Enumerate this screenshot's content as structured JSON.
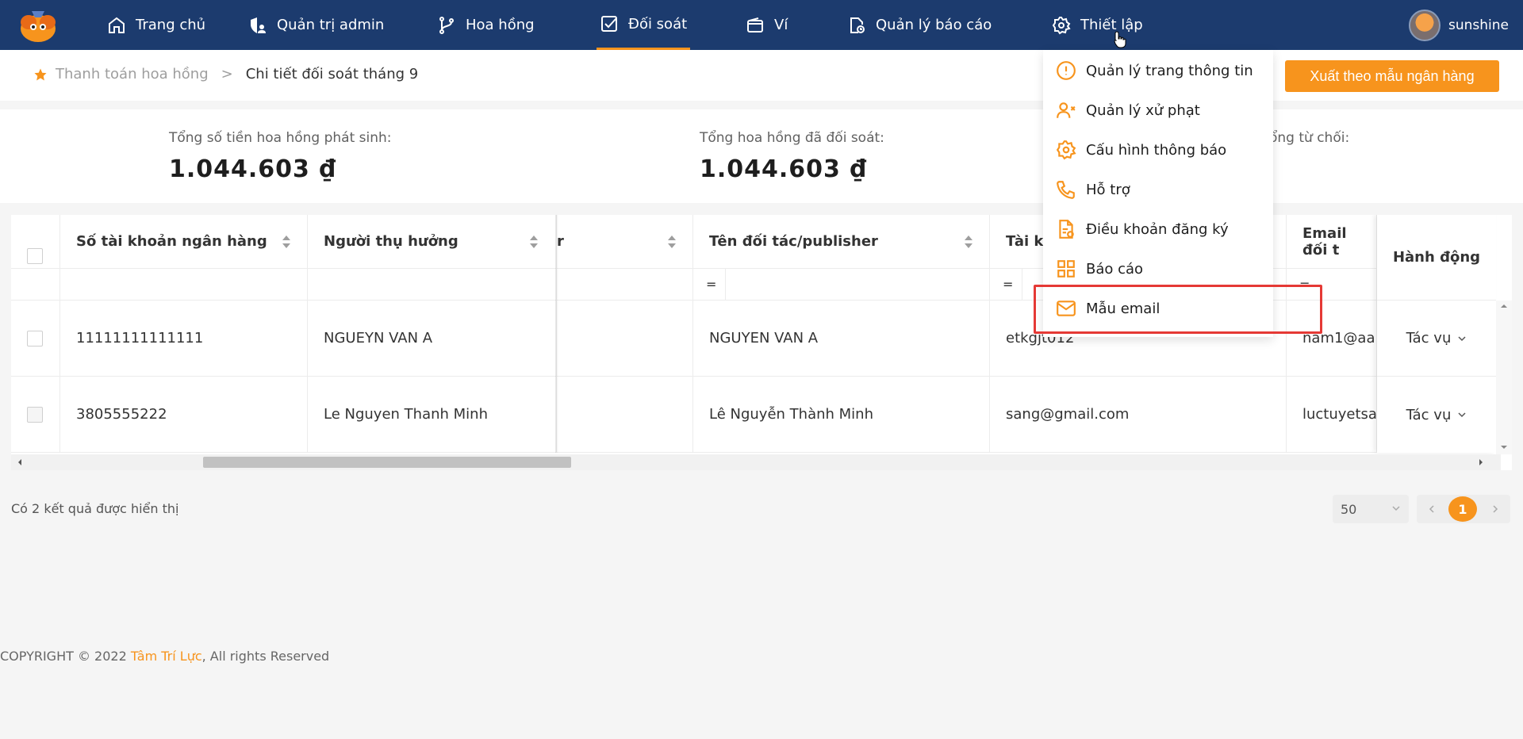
{
  "nav": {
    "items": [
      {
        "label": "Trang chủ",
        "icon": "home-icon"
      },
      {
        "label": "Quản trị admin",
        "icon": "shield-user-icon"
      },
      {
        "label": "Hoa hồng",
        "icon": "branch-icon"
      },
      {
        "label": "Đối soát",
        "icon": "check-square-icon"
      },
      {
        "label": "Ví",
        "icon": "wallet-icon"
      },
      {
        "label": "Quản lý báo cáo",
        "icon": "report-clock-icon"
      },
      {
        "label": "Thiết lập",
        "icon": "gear-icon"
      }
    ],
    "active": "Đối soát",
    "user": "sunshine"
  },
  "breadcrumb": {
    "parent": "Thanh toán hoa hồng",
    "separator": ">",
    "current": "Chi tiết đối soát tháng 9"
  },
  "export_button": "Xuất theo mẫu ngân hàng",
  "stats": [
    {
      "label": "Tổng số tiền hoa hồng phát sinh:",
      "value": "1.044.603 ₫"
    },
    {
      "label": "Tổng hoa hồng đã đối soát:",
      "value": "1.044.603 ₫"
    },
    {
      "label": "ổng từ chối:",
      "value": ""
    }
  ],
  "table": {
    "columns": [
      "Số tài khoản ngân hàng",
      "Người thụ hưởng",
      "r",
      "Tên đối tác/publisher",
      "Tài kh",
      "Email đối t",
      "Hành động"
    ],
    "filter_ops": [
      "=",
      "=",
      "="
    ],
    "rows": [
      {
        "account": "11111111111111",
        "beneficiary": "NGUEYN VAN A",
        "partner": "NGUYEN VAN A",
        "user": "etkgjt012",
        "email": "nam1@aa",
        "action": "Tác vụ"
      },
      {
        "account": "3805555222",
        "beneficiary": "Le Nguyen Thanh Minh",
        "partner": "Lê Nguyễn Thành Minh",
        "user": "sang@gmail.com",
        "email": "luctuyetsa",
        "action": "Tác vụ"
      }
    ]
  },
  "result_count": "Có 2 kết quả được hiển thị",
  "page_size": "50",
  "current_page": "1",
  "footer": {
    "prefix": "COPYRIGHT © 2022 ",
    "brand": "Tâm Trí Lực",
    "suffix": ", All rights Reserved"
  },
  "dropdown": {
    "items": [
      {
        "label": "Quản lý trang thông tin",
        "icon": "alert-circle-icon"
      },
      {
        "label": "Quản lý xử phạt",
        "icon": "user-x-icon"
      },
      {
        "label": "Cấu hình thông báo",
        "icon": "gear-icon"
      },
      {
        "label": "Hỗ trợ",
        "icon": "phone-icon"
      },
      {
        "label": "Điều khoản đăng ký",
        "icon": "document-icon"
      },
      {
        "label": "Báo cáo",
        "icon": "grid-icon"
      },
      {
        "label": "Mẫu email",
        "icon": "mail-icon"
      }
    ]
  },
  "colors": {
    "nav_bg": "#1c3b6e",
    "accent": "#f7941d",
    "highlight": "#e53935"
  }
}
